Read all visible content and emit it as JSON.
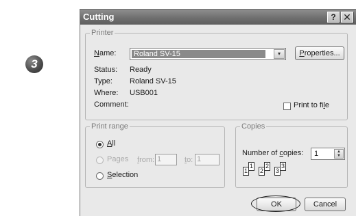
{
  "step": {
    "number": "3"
  },
  "window": {
    "title": "Cutting",
    "help_glyph": "?",
    "close_glyph": "✕"
  },
  "printer": {
    "group_label": "Printer",
    "name_label": "Name:",
    "name_value": "Roland SV-15",
    "properties_label": "Properties...",
    "status_label": "Status:",
    "status_value": "Ready",
    "type_label": "Type:",
    "type_value": "Roland SV-15",
    "where_label": "Where:",
    "where_value": "USB001",
    "comment_label": "Comment:",
    "print_to_file_label": "Print to file",
    "print_to_file_checked": false
  },
  "print_range": {
    "group_label": "Print range",
    "all_label": "All",
    "pages_label": "Pages",
    "from_label": "from:",
    "from_value": "1",
    "to_label": "to:",
    "to_value": "1",
    "selection_label": "Selection",
    "selected": "All"
  },
  "copies": {
    "group_label": "Copies",
    "number_label": "Number of copies:",
    "number_value": "1",
    "collate_glyphs": [
      "1",
      "1",
      "2",
      "2",
      "3",
      "3"
    ]
  },
  "buttons": {
    "ok_label": "OK",
    "cancel_label": "Cancel"
  },
  "icons": {
    "combo_arrow": "▾",
    "spin_up": "▲",
    "spin_down": "▼"
  }
}
